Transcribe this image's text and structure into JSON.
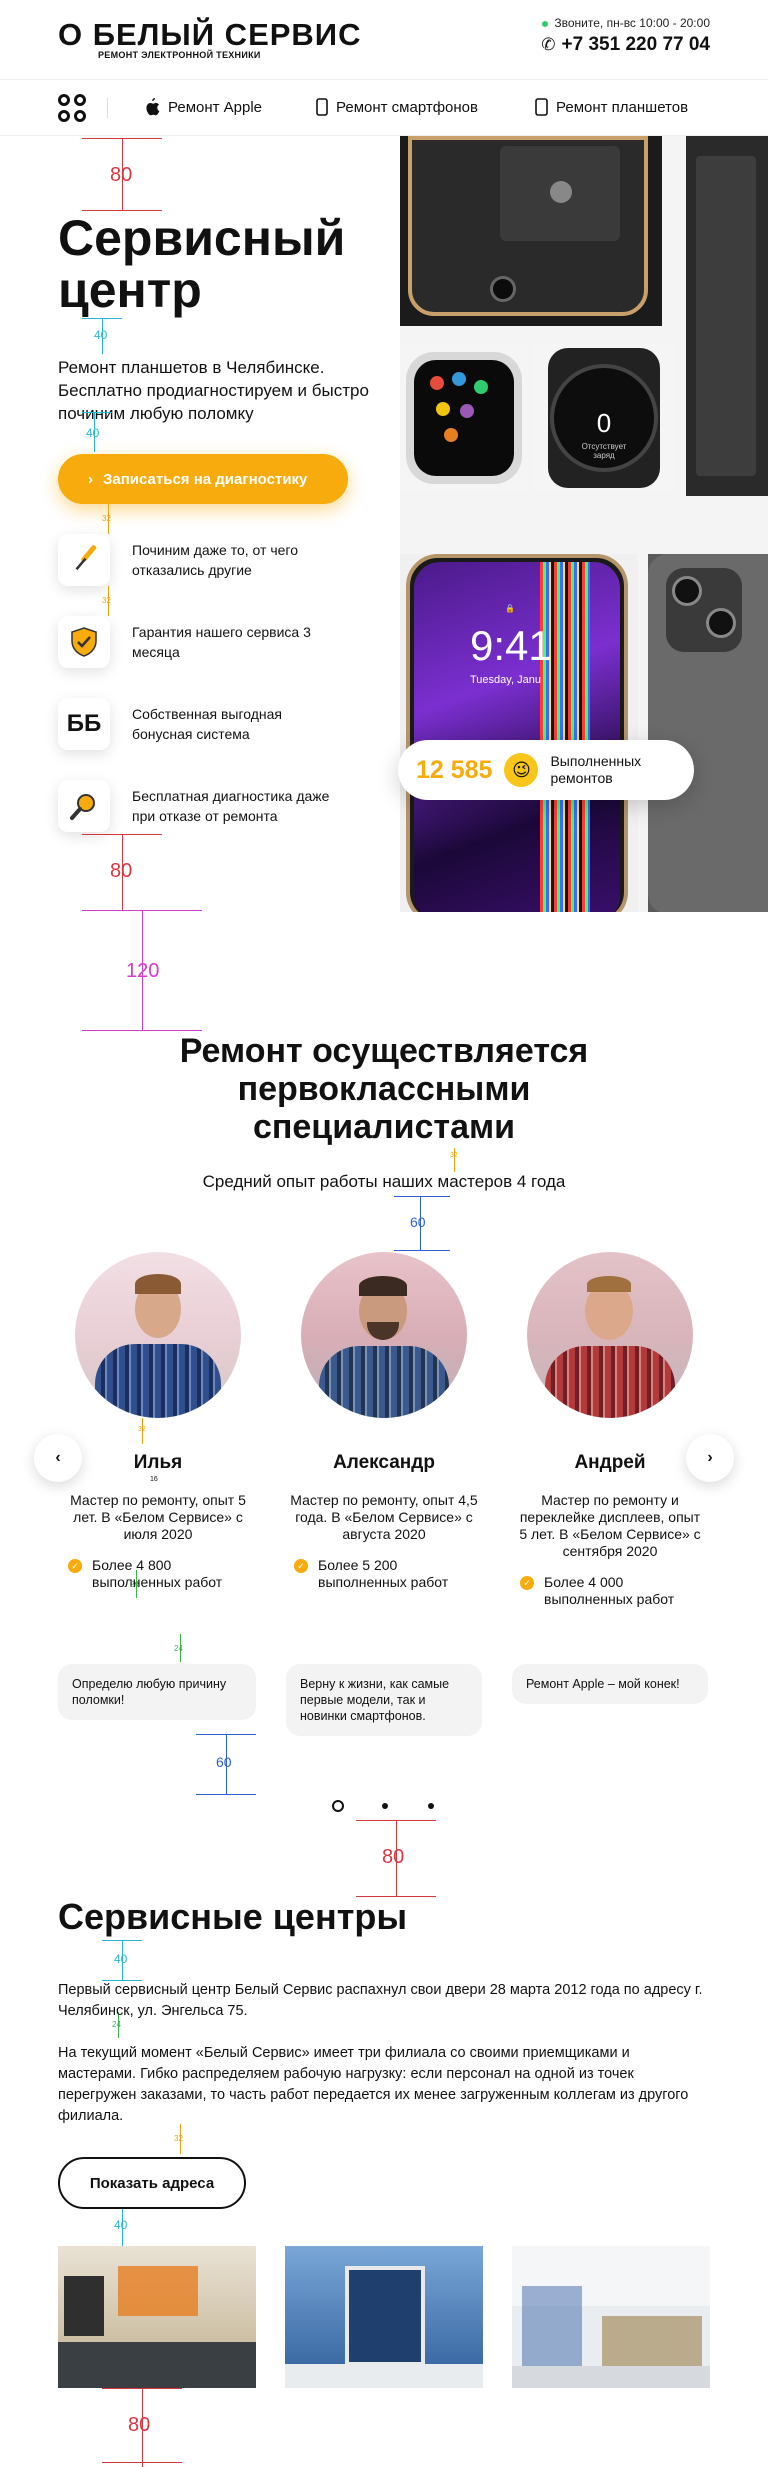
{
  "header": {
    "logo_text": "О БЕЛЫЙ СЕРВИС",
    "logo_subtitle": "РЕМОНТ ЭЛЕКТРОННОЙ ТЕХНИКИ",
    "hours": "Звоните, пн-вс 10:00 - 20:00",
    "phone": "+7 351 220 77 04"
  },
  "nav": {
    "items": [
      {
        "label": "Ремонт Apple",
        "icon": "apple-icon"
      },
      {
        "label": "Ремонт смартфонов",
        "icon": "smartphone-icon"
      },
      {
        "label": "Ремонт планшетов",
        "icon": "tablet-icon"
      }
    ]
  },
  "hero": {
    "title_line1": "Сервисный",
    "title_line2": "центр",
    "subtitle": "Ремонт планшетов в Челябинске. Бесплатно продиагностируем и быстро починим любую поломку",
    "cta": "Записаться на диагностику",
    "features": [
      {
        "text": "Починим даже то, от чего отказались другие",
        "icon": "screwdriver-icon"
      },
      {
        "text": "Гарантия нашего сервиса 3 месяца",
        "icon": "shield-icon"
      },
      {
        "text": "Собственная выгодная бонусная система",
        "icon": "bonus-icon",
        "glyph": "ББ"
      },
      {
        "text": "Бесплатная диагностика даже при отказе от ремонта",
        "icon": "magnifier-icon"
      }
    ],
    "counter_value": "12 585",
    "counter_label": "Выполненных ремонтов",
    "watch_time": "0",
    "watch_label": "Отсутствует заряд",
    "phone_time": "9:41",
    "phone_date": "Tuesday, Janu"
  },
  "guides": {
    "hero_top": "80",
    "title_gap": "40",
    "sub_gap": "40",
    "btn_gap": "32",
    "feat_gap": "32",
    "hero_bottom": "80",
    "section_gap": "120",
    "title_sub_gap": "32",
    "sub_team_gap": "60",
    "avatar_name_gap": "32",
    "name_role_gap": "16",
    "stat_gap": "24",
    "stat_gap2": "24",
    "quote_gap": "60",
    "dots_gap": "80",
    "centers_title_gap": "40",
    "para_gap": "24",
    "btn_gap2": "32",
    "photos_gap": "40",
    "photos_bottom": "80"
  },
  "team": {
    "title": "Ремонт осуществляется первоклассными специалистами",
    "subtitle": "Средний опыт работы наших мастеров 4 года",
    "members": [
      {
        "name": "Илья",
        "role": "Мастер по ремонту, опыт 5 лет. В «Белом Сервисе» с июля 2020",
        "stat": "Более 4 800 выполненных работ",
        "quote": "Определю любую причину поломки!"
      },
      {
        "name": "Александр",
        "role": "Мастер по ремонту, опыт 4,5 года. В «Белом Сервисе» с августа 2020",
        "stat": "Более 5 200 выполненных работ",
        "quote": "Верну к жизни, как самые первые модели, так и новинки  смартфонов."
      },
      {
        "name": "Андрей",
        "role": "Мастер по ремонту и переклейке дисплеев, опыт 5 лет. В «Белом Сервисе» с сентября 2020",
        "stat": "Более 4 000 выполненных работ",
        "quote": "Ремонт Apple – мой конек!"
      }
    ]
  },
  "centers": {
    "title": "Сервисные центры",
    "para1": "Первый сервисный центр Белый Сервис распахнул свои двери 28 марта 2012 года по адресу г. Челябинск, ул. Энгельса 75.",
    "para2": "На текущий момент «Белый Сервис» имеет три филиала со своими приемщиками и мастерами. Гибко распределяем рабочую нагрузку: если персонал на одной из точек перегружен заказами, то часть работ передается их менее загруженным коллегам из другого филиала.",
    "button": "Показать адреса"
  },
  "colors": {
    "accent": "#f7ab0c",
    "guide_red": "#d9363e",
    "guide_cyan": "#22b8d6",
    "guide_magenta": "#d63ad0",
    "guide_blue": "#2f5fd8",
    "guide_green": "#39b54a",
    "guide_orange": "#f0a20a"
  }
}
